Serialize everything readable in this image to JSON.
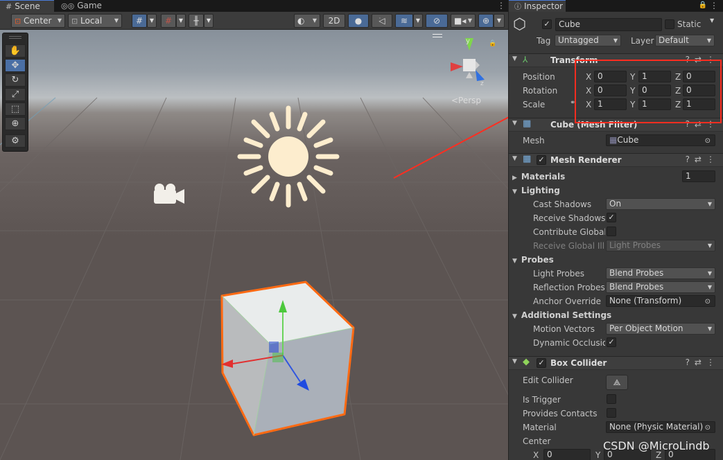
{
  "scene_tabs": {
    "scene": "Scene",
    "game": "Game"
  },
  "toolbar": {
    "pivot": "Center",
    "space": "Local",
    "mode_2d": "2D"
  },
  "gizmo": {
    "y": "y",
    "z": "z",
    "persp": "<Persp"
  },
  "inspector": {
    "tab": "Inspector",
    "object_name": "Cube",
    "static_label": "Static",
    "tag_label": "Tag",
    "tag_value": "Untagged",
    "layer_label": "Layer",
    "layer_value": "Default",
    "transform": {
      "title": "Transform",
      "position_label": "Position",
      "rotation_label": "Rotation",
      "scale_label": "Scale",
      "x": "X",
      "y": "Y",
      "z": "Z",
      "position": {
        "x": "0",
        "y": "1",
        "z": "0"
      },
      "rotation": {
        "x": "0",
        "y": "0",
        "z": "0"
      },
      "scale": {
        "x": "1",
        "y": "1",
        "z": "1"
      }
    },
    "mesh_filter": {
      "title": "Cube (Mesh Filter)",
      "mesh_label": "Mesh",
      "mesh_value": "Cube"
    },
    "mesh_renderer": {
      "title": "Mesh Renderer",
      "materials_label": "Materials",
      "materials_count": "1",
      "lighting_label": "Lighting",
      "cast_shadows_label": "Cast Shadows",
      "cast_shadows_value": "On",
      "receive_shadows_label": "Receive Shadows",
      "contribute_gi_label": "Contribute Global I",
      "receive_gi_label": "Receive Global Illu",
      "receive_gi_value": "Light Probes",
      "probes_label": "Probes",
      "light_probes_label": "Light Probes",
      "light_probes_value": "Blend Probes",
      "reflection_probes_label": "Reflection Probes",
      "reflection_probes_value": "Blend Probes",
      "anchor_override_label": "Anchor Override",
      "anchor_override_value": "None (Transform)",
      "additional_label": "Additional Settings",
      "motion_vectors_label": "Motion Vectors",
      "motion_vectors_value": "Per Object Motion",
      "dynamic_occlusion_label": "Dynamic Occlusion"
    },
    "box_collider": {
      "title": "Box Collider",
      "edit_collider_label": "Edit Collider",
      "is_trigger_label": "Is Trigger",
      "provides_contacts_label": "Provides Contacts",
      "material_label": "Material",
      "material_value": "None (Physic Material)",
      "center_label": "Center",
      "center": {
        "x": "0",
        "y": "0",
        "z": "0"
      }
    }
  },
  "watermark": "CSDN @MicroLindb",
  "colors": {
    "highlight": "#ff2d20",
    "cube_outline": "#ff6a13",
    "selected_tab": "#4a7cd8"
  }
}
